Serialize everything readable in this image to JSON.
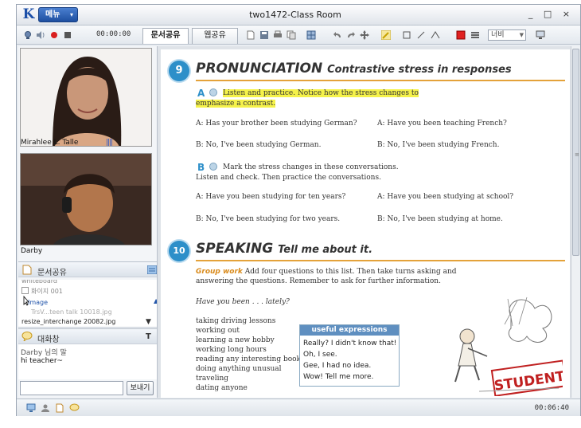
{
  "window": {
    "title": "two1472-Class Room",
    "controls": "_ □ ×"
  },
  "menu": {
    "label": "메뉴",
    "caret": "▾"
  },
  "toolbar": {
    "timer": "00:00:00",
    "tabs": [
      {
        "label": "문서공유"
      },
      {
        "label": "웹공유"
      }
    ],
    "width_select": "너비",
    "icons": [
      "camera-icon",
      "speaker-icon",
      "record-icon",
      "stop-icon",
      "new-page-icon",
      "save-icon",
      "print-icon",
      "copy-icon",
      "grid-icon",
      "undo-icon",
      "redo-icon",
      "move-icon",
      "pen-icon",
      "rect-icon",
      "line-icon",
      "shape-icon",
      "color-icon",
      "line-weight-icon",
      "monitor-icon"
    ]
  },
  "participants": [
    {
      "name": "Mirahlee L. Talle",
      "signal": "||||"
    },
    {
      "name": "Darby"
    }
  ],
  "doc_share": {
    "title": "문서공유",
    "items": [
      {
        "label": "whiteboard"
      },
      {
        "label": "화이지 001"
      },
      {
        "label": "Image"
      },
      {
        "label": "TrsV...teen talk 10018.jpg"
      },
      {
        "label": "resize_interchange 20082.jpg"
      }
    ]
  },
  "chat": {
    "title": "대화창",
    "messages": [
      {
        "text": "Darby 님의 말"
      },
      {
        "text": "hi teacher~"
      }
    ],
    "send_label": "보내기",
    "input_value": ""
  },
  "page": {
    "section9": {
      "number": "9",
      "title": "PRONUNCIATION",
      "subtitle": "Contrastive stress in responses",
      "a_letter": "A",
      "a_instr_line1": "Listen and practice. Notice how the stress changes to",
      "a_instr_line2": "emphasize a contrast.",
      "a_rows": [
        {
          "left": "A: Has your brother been studying German?",
          "right": "A: Have you been teaching French?"
        },
        {
          "left": "B: No, I've been studying German.",
          "right": "B: No, I've been studying French."
        }
      ],
      "b_letter": "B",
      "b_instr_line1": "Mark the stress changes in these conversations.",
      "b_instr_line2": "Listen and check. Then practice the conversations.",
      "b_rows": [
        {
          "left": "A: Have you been studying for ten years?",
          "right": "A: Have you been studying at school?"
        },
        {
          "left": "B: No, I've been studying for two years.",
          "right": "B: No, I've been studying at home."
        }
      ]
    },
    "section10": {
      "number": "10",
      "title": "SPEAKING",
      "subtitle": "Tell me about it.",
      "group_work": "Group work",
      "instr_line1": "Add four questions to this list. Then take turns asking and",
      "instr_line2": "answering the questions. Remember to ask for further information.",
      "prompt": "Have you been . . . lately?",
      "list": [
        "taking driving lessons",
        "working out",
        "learning a new hobby",
        "working long hours",
        "reading any interesting books",
        "doing anything unusual",
        "traveling",
        "dating anyone"
      ],
      "useful": {
        "title": "useful expressions",
        "lines": [
          "Really? I didn't know that!",
          "Oh, I see.",
          "Gee, I had no idea.",
          "Wow! Tell me more."
        ]
      },
      "sign_text": "STUDENT"
    }
  },
  "status": {
    "time": "00:06:40"
  }
}
